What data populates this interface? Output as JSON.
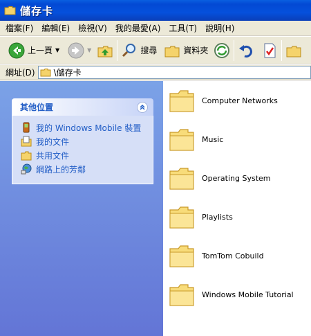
{
  "window": {
    "title": "儲存卡"
  },
  "menu": [
    "檔案(F)",
    "編輯(E)",
    "檢視(V)",
    "我的最愛(A)",
    "工具(T)",
    "說明(H)"
  ],
  "toolbar": {
    "back_label": "上一頁",
    "search_label": "搜尋",
    "folders_label": "資料夾"
  },
  "address": {
    "label": "網址(D)",
    "path": "\\儲存卡"
  },
  "tasks": {
    "title": "其他位置",
    "links": [
      {
        "label": "我的 Windows Mobile 裝置",
        "icon": "mobile-device-icon"
      },
      {
        "label": "我的文件",
        "icon": "my-documents-icon"
      },
      {
        "label": "共用文件",
        "icon": "shared-folder-icon"
      },
      {
        "label": "網路上的芳鄰",
        "icon": "network-places-icon"
      }
    ]
  },
  "folders": [
    "Computer Networks",
    "Music",
    "Operating System",
    "Playlists",
    "TomTom Cobuild",
    "Windows Mobile Tutorial"
  ],
  "colors": {
    "title_bar": "#0550dc",
    "task_link": "#215dc6",
    "left_pane_top": "#7ba2e7",
    "left_pane_bottom": "#6375d6"
  }
}
